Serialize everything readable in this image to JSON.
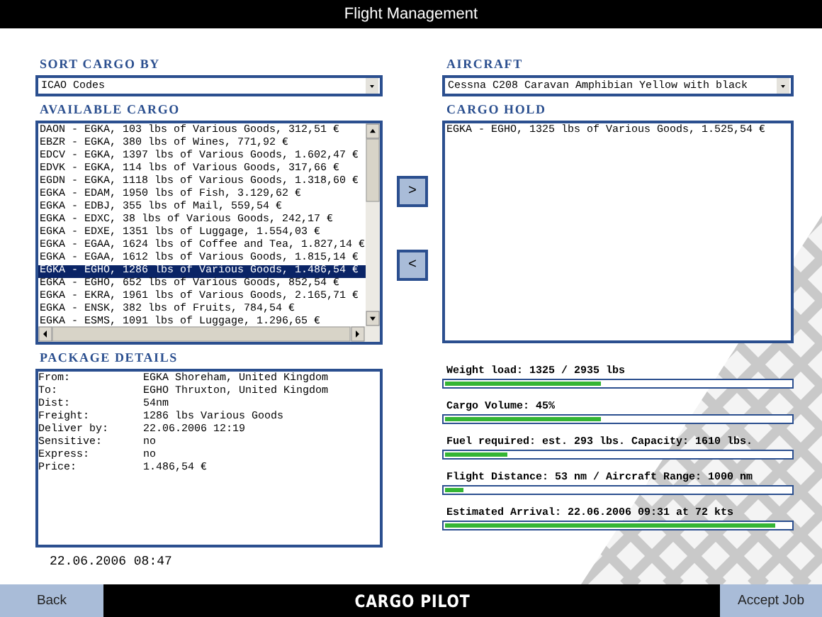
{
  "window": {
    "title": "Flight Management"
  },
  "sort": {
    "label": "SORT CARGO BY",
    "value": "ICAO Codes"
  },
  "available": {
    "label": "AVAILABLE CARGO",
    "rows": [
      {
        "text": "DAON - EGKA, 103 lbs of Various Goods, 312,51 €",
        "selected": false
      },
      {
        "text": "EBZR - EGKA, 380 lbs of Wines, 771,92 €",
        "selected": false
      },
      {
        "text": "EDCV - EGKA, 1397 lbs of Various Goods, 1.602,47 €",
        "selected": false
      },
      {
        "text": "EDVK - EGKA, 114 lbs of Various Goods, 317,66 €",
        "selected": false
      },
      {
        "text": "EGDN - EGKA, 1118 lbs of Various Goods, 1.318,60 €",
        "selected": false
      },
      {
        "text": "EGKA - EDAM, 1950 lbs of Fish, 3.129,62 €",
        "selected": false
      },
      {
        "text": "EGKA - EDBJ, 355 lbs of Mail, 559,54 €",
        "selected": false
      },
      {
        "text": "EGKA - EDXC, 38 lbs of Various Goods, 242,17 €",
        "selected": false
      },
      {
        "text": "EGKA - EDXE, 1351 lbs of Luggage, 1.554,03 €",
        "selected": false
      },
      {
        "text": "EGKA - EGAA, 1624 lbs of Coffee and Tea, 1.827,14 €",
        "selected": false
      },
      {
        "text": "EGKA - EGAA, 1612 lbs of Various Goods, 1.815,14 €",
        "selected": false
      },
      {
        "text": "EGKA - EGHO, 1286 lbs of Various Goods, 1.486,54 €",
        "selected": true
      },
      {
        "text": "EGKA - EGHO, 652 lbs of Various Goods, 852,54 €",
        "selected": false
      },
      {
        "text": "EGKA - EKRA, 1961 lbs of Various Goods, 2.165,71 €",
        "selected": false
      },
      {
        "text": "EGKA - ENSK, 382 lbs of Fruits, 784,54 €",
        "selected": false
      },
      {
        "text": "EGKA - ESMS, 1091 lbs of Luggage, 1.296,65 €",
        "selected": false
      }
    ]
  },
  "transfer_buttons": [
    ">",
    "<"
  ],
  "aircraft": {
    "label": "AIRCRAFT",
    "value": "Cessna C208 Caravan Amphibian Yellow with black"
  },
  "cargo_hold": {
    "label": "CARGO HOLD",
    "rows": [
      "EGKA - EGHO, 1325 lbs of Various Goods, 1.525,54 €"
    ]
  },
  "package_details": {
    "label": "PACKAGE DETAILS",
    "fields": [
      {
        "label": "From:",
        "value": "EGKA Shoreham, United Kingdom"
      },
      {
        "label": "To:",
        "value": "EGHO Thruxton, United Kingdom"
      },
      {
        "label": "Dist:",
        "value": "54nm"
      },
      {
        "label": "Freight:",
        "value": "1286 lbs Various Goods"
      },
      {
        "label": "Deliver by:",
        "value": "22.06.2006 12:19"
      },
      {
        "label": "Sensitive:",
        "value": "no"
      },
      {
        "label": "Express:",
        "value": "no"
      },
      {
        "label": "Price:",
        "value": "1.486,54 €"
      }
    ]
  },
  "clock": "22.06.2006 08:47",
  "meters": [
    {
      "label": "Weight load: 1325 / 2935 lbs",
      "level": 0.45
    },
    {
      "label": "Cargo Volume: 45%",
      "level": 0.45
    },
    {
      "label": "Fuel required: est. 293 lbs. Capacity: 1610 lbs.",
      "level": 0.18
    },
    {
      "label": "Flight Distance: 53 nm / Aircraft Range: 1000 nm",
      "level": 0.053
    },
    {
      "label": "Estimated Arrival: 22.06.2006 09:31 at 72 kts",
      "level": 0.955
    }
  ],
  "footer": {
    "back": "Back",
    "logo": "CARGO PILOT",
    "accept": "Accept Job"
  }
}
